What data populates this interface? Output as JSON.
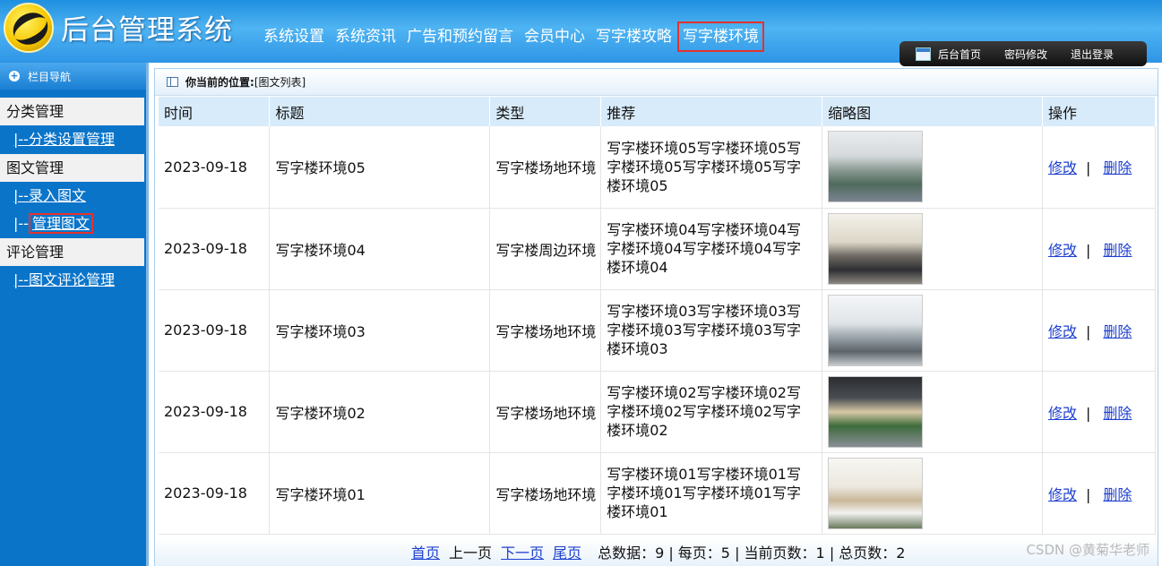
{
  "header": {
    "title": "后台管理系统",
    "nav": [
      "系统设置",
      "系统资讯",
      "广告和预约留言",
      "会员中心",
      "写字楼攻略",
      "写字楼环境"
    ],
    "toolbar": [
      "后台首页",
      "密码修改",
      "退出登录"
    ]
  },
  "sidebar": {
    "header": "栏目导航",
    "groups": [
      {
        "label": "分类管理",
        "links": [
          "|--分类设置管理"
        ]
      },
      {
        "label": "图文管理",
        "links": [
          "|--录入图文",
          "管理图文"
        ],
        "link_prefix": "|--"
      },
      {
        "label": "评论管理",
        "links": [
          "|--图文评论管理"
        ]
      }
    ]
  },
  "breadcrumb": {
    "label": "你当前的位置:",
    "value": "[图文列表]"
  },
  "table": {
    "columns": [
      "时间",
      "标题",
      "类型",
      "推荐",
      "缩略图",
      "操作"
    ],
    "rows": [
      {
        "time": "2023-09-18",
        "title": "写字楼环境05",
        "type": "写字楼场地环境",
        "rec": "写字楼环境05写字楼环境05写字楼环境05写字楼环境05写字楼环境05",
        "edit": "修改",
        "sep": "|",
        "del": "删除"
      },
      {
        "time": "2023-09-18",
        "title": "写字楼环境04",
        "type": "写字楼周边环境",
        "rec": "写字楼环境04写字楼环境04写字楼环境04写字楼环境04写字楼环境04",
        "edit": "修改",
        "sep": "|",
        "del": "删除"
      },
      {
        "time": "2023-09-18",
        "title": "写字楼环境03",
        "type": "写字楼场地环境",
        "rec": "写字楼环境03写字楼环境03写字楼环境03写字楼环境03写字楼环境03",
        "edit": "修改",
        "sep": "|",
        "del": "删除"
      },
      {
        "time": "2023-09-18",
        "title": "写字楼环境02",
        "type": "写字楼场地环境",
        "rec": "写字楼环境02写字楼环境02写字楼环境02写字楼环境02写字楼环境02",
        "edit": "修改",
        "sep": "|",
        "del": "删除"
      },
      {
        "time": "2023-09-18",
        "title": "写字楼环境01",
        "type": "写字楼场地环境",
        "rec": "写字楼环境01写字楼环境01写字楼环境01写字楼环境01写字楼环境01",
        "edit": "修改",
        "sep": "|",
        "del": "删除"
      }
    ]
  },
  "pager": {
    "first": "首页",
    "prev": "上一页",
    "next": "下一页",
    "last": "尾页",
    "stats": "总数据：9 | 每页：5 | 当前页数：1 | 总页数：2"
  },
  "watermark": "CSDN @黄菊华老师",
  "colors": {
    "accent": "#0a74c9",
    "highlight_box": "#e5322d",
    "link": "#1d3fcf"
  }
}
